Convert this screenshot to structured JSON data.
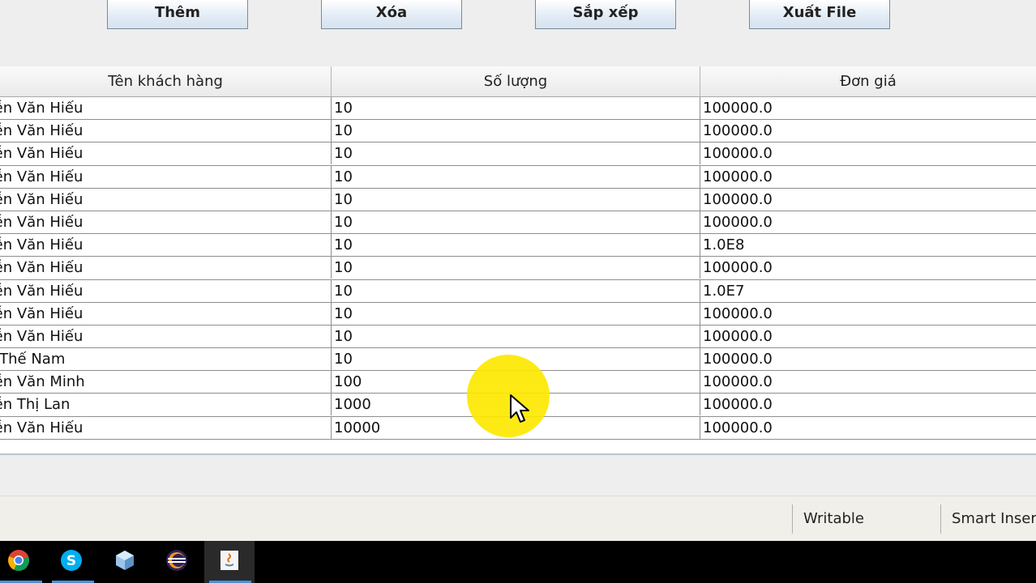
{
  "toolbar": {
    "buttons": [
      {
        "label": "Thêm"
      },
      {
        "label": "Xóa"
      },
      {
        "label": "Sắp xếp"
      },
      {
        "label": "Xuất File"
      }
    ]
  },
  "table": {
    "columns": [
      "Tên khách hàng",
      "Số lượng",
      "Đơn giá"
    ],
    "rows": [
      {
        "name": "yễn Văn Hiếu",
        "qty": "10",
        "price": "100000.0"
      },
      {
        "name": "yễn Văn Hiếu",
        "qty": "10",
        "price": "100000.0"
      },
      {
        "name": "yễn Văn Hiếu",
        "qty": "10",
        "price": "100000.0"
      },
      {
        "name": "yễn Văn Hiếu",
        "qty": "10",
        "price": "100000.0"
      },
      {
        "name": "yễn Văn Hiếu",
        "qty": "10",
        "price": "100000.0"
      },
      {
        "name": "yễn Văn Hiếu",
        "qty": "10",
        "price": "100000.0"
      },
      {
        "name": "yễn Văn Hiếu",
        "qty": "10",
        "price": "1.0E8"
      },
      {
        "name": "yễn Văn Hiếu",
        "qty": "10",
        "price": "100000.0"
      },
      {
        "name": "yễn Văn Hiếu",
        "qty": "10",
        "price": "1.0E7"
      },
      {
        "name": "yễn Văn Hiếu",
        "qty": "10",
        "price": "100000.0"
      },
      {
        "name": "yễn Văn Hiếu",
        "qty": "10",
        "price": "100000.0"
      },
      {
        "name": "n Thế Nam",
        "qty": "10",
        "price": "100000.0"
      },
      {
        "name": "yễn Văn Minh",
        "qty": "100",
        "price": "100000.0"
      },
      {
        "name": "yễn Thị Lan",
        "qty": "1000",
        "price": "100000.0"
      },
      {
        "name": "yễn Văn Hiếu",
        "qty": "10000",
        "price": "100000.0"
      }
    ]
  },
  "statusbar": {
    "writable": "Writable",
    "insert_mode": "Smart Inser"
  },
  "taskbar": {
    "icons": [
      "chrome-icon",
      "skype-icon",
      "virtualbox-icon",
      "eclipse-icon",
      "java-app-icon"
    ],
    "active_index": 4
  },
  "colors": {
    "highlight": "#fde800",
    "taskbar": "#000000",
    "button_gradient_bottom": "#d6e2ef"
  }
}
